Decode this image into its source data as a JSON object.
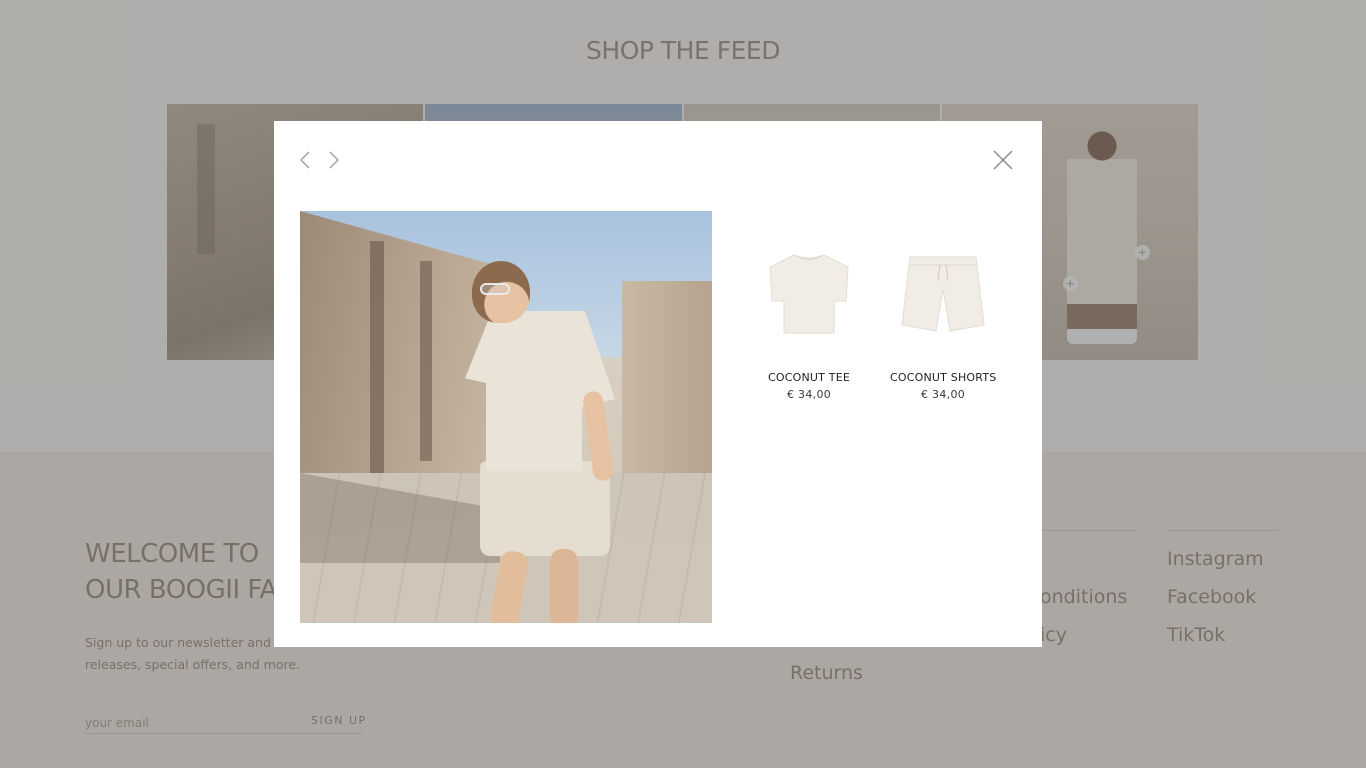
{
  "feed": {
    "title": "SHOP THE FEED",
    "hotspot_symbol": "+"
  },
  "footer": {
    "welcome_line1": "WELCOME TO",
    "welcome_line2": "OUR BOOGII FA",
    "signup_text": "Sign up to our newsletter and be receive new releases, special offers, and more.",
    "email_placeholder": "your email",
    "signup_button": "SIGN UP",
    "links_col2": [
      "onditions",
      "icy"
    ],
    "link_returns": "Returns",
    "social_links": [
      "Instagram",
      "Facebook",
      "TikTok"
    ]
  },
  "modal": {
    "prev_icon": "chevron-left-icon",
    "next_icon": "chevron-right-icon",
    "close_icon": "close-icon",
    "products": [
      {
        "name": "COCONUT TEE",
        "price": "€ 34,00",
        "icon": "tshirt-icon"
      },
      {
        "name": "COCONUT SHORTS",
        "price": "€ 34,00",
        "icon": "shorts-icon"
      }
    ]
  },
  "colors": {
    "overlay": "#696969",
    "modal_bg": "#ffffff",
    "accent_text": "#8a7565"
  }
}
